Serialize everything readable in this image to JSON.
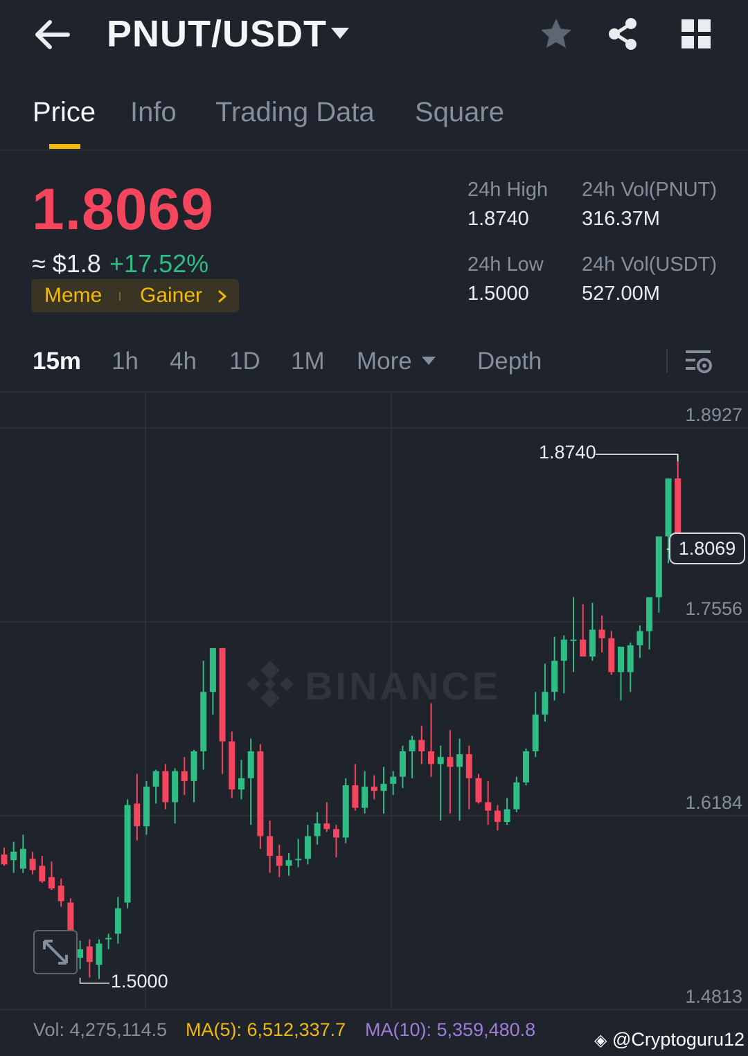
{
  "header": {
    "pair": "PNUT/USDT"
  },
  "tabs": [
    "Price",
    "Info",
    "Trading Data",
    "Square"
  ],
  "price": {
    "last": "1.8069",
    "approx": "≈ $1.8",
    "change": "+17.52%",
    "tags": [
      "Meme",
      "Gainer"
    ]
  },
  "stats": {
    "high_label": "24h High",
    "high": "1.8740",
    "low_label": "24h Low",
    "low": "1.5000",
    "vol_base_label": "24h Vol(PNUT)",
    "vol_base": "316.37M",
    "vol_quote_label": "24h Vol(USDT)",
    "vol_quote": "527.00M"
  },
  "intervals": [
    "15m",
    "1h",
    "4h",
    "1D",
    "1M",
    "More",
    "Depth"
  ],
  "chart": {
    "axis_labels": [
      "1.8927",
      "1.7556",
      "1.6184",
      "1.4813"
    ],
    "high_annotation": "1.8740",
    "low_annotation": "1.5000",
    "current_price": "1.8069",
    "watermark": "BINANCE"
  },
  "footer": {
    "vol": "Vol: 4,275,114.5",
    "ma5": "MA(5): 6,512,337.7",
    "ma10": "MA(10): 5,359,480.8",
    "credit": "@Cryptoguru12"
  },
  "colors": {
    "up": "#2ebd85",
    "down": "#f6465d",
    "accent": "#f0b90b",
    "ma5": "#f0b90b",
    "ma10": "#9c7ed8"
  },
  "chart_data": {
    "type": "candlestick",
    "y_range": [
      1.4813,
      1.8927
    ],
    "axis_ticks": [
      1.8927,
      1.7556,
      1.6184,
      1.4813
    ],
    "candles": [
      {
        "o": 1.591,
        "h": 1.596,
        "l": 1.583,
        "c": 1.584
      },
      {
        "o": 1.587,
        "h": 1.6,
        "l": 1.578,
        "c": 1.593
      },
      {
        "o": 1.581,
        "h": 1.605,
        "l": 1.578,
        "c": 1.595
      },
      {
        "o": 1.588,
        "h": 1.593,
        "l": 1.577,
        "c": 1.58
      },
      {
        "o": 1.583,
        "h": 1.59,
        "l": 1.571,
        "c": 1.572
      },
      {
        "o": 1.575,
        "h": 1.586,
        "l": 1.566,
        "c": 1.567
      },
      {
        "o": 1.569,
        "h": 1.574,
        "l": 1.554,
        "c": 1.558
      },
      {
        "o": 1.557,
        "h": 1.56,
        "l": 1.515,
        "c": 1.523
      },
      {
        "o": 1.518,
        "h": 1.53,
        "l": 1.51,
        "c": 1.524
      },
      {
        "o": 1.526,
        "h": 1.531,
        "l": 1.504,
        "c": 1.515
      },
      {
        "o": 1.513,
        "h": 1.531,
        "l": 1.503,
        "c": 1.528
      },
      {
        "o": 1.531,
        "h": 1.535,
        "l": 1.524,
        "c": 1.532
      },
      {
        "o": 1.535,
        "h": 1.561,
        "l": 1.528,
        "c": 1.553
      },
      {
        "o": 1.557,
        "h": 1.63,
        "l": 1.553,
        "c": 1.626
      },
      {
        "o": 1.627,
        "h": 1.648,
        "l": 1.601,
        "c": 1.611
      },
      {
        "o": 1.611,
        "h": 1.643,
        "l": 1.605,
        "c": 1.639
      },
      {
        "o": 1.639,
        "h": 1.651,
        "l": 1.627,
        "c": 1.65
      },
      {
        "o": 1.65,
        "h": 1.655,
        "l": 1.623,
        "c": 1.628
      },
      {
        "o": 1.628,
        "h": 1.652,
        "l": 1.613,
        "c": 1.65
      },
      {
        "o": 1.65,
        "h": 1.66,
        "l": 1.633,
        "c": 1.643
      },
      {
        "o": 1.643,
        "h": 1.665,
        "l": 1.628,
        "c": 1.664
      },
      {
        "o": 1.664,
        "h": 1.728,
        "l": 1.651,
        "c": 1.706
      },
      {
        "o": 1.706,
        "h": 1.734,
        "l": 1.69,
        "c": 1.737
      },
      {
        "o": 1.737,
        "h": 1.715,
        "l": 1.648,
        "c": 1.671
      },
      {
        "o": 1.671,
        "h": 1.678,
        "l": 1.631,
        "c": 1.637
      },
      {
        "o": 1.637,
        "h": 1.658,
        "l": 1.63,
        "c": 1.645
      },
      {
        "o": 1.645,
        "h": 1.673,
        "l": 1.612,
        "c": 1.664
      },
      {
        "o": 1.664,
        "h": 1.669,
        "l": 1.595,
        "c": 1.604
      },
      {
        "o": 1.604,
        "h": 1.615,
        "l": 1.578,
        "c": 1.59
      },
      {
        "o": 1.59,
        "h": 1.598,
        "l": 1.575,
        "c": 1.583
      },
      {
        "o": 1.583,
        "h": 1.592,
        "l": 1.576,
        "c": 1.587
      },
      {
        "o": 1.587,
        "h": 1.602,
        "l": 1.582,
        "c": 1.588
      },
      {
        "o": 1.588,
        "h": 1.612,
        "l": 1.584,
        "c": 1.604
      },
      {
        "o": 1.604,
        "h": 1.621,
        "l": 1.598,
        "c": 1.613
      },
      {
        "o": 1.613,
        "h": 1.628,
        "l": 1.607,
        "c": 1.609
      },
      {
        "o": 1.609,
        "h": 1.612,
        "l": 1.589,
        "c": 1.603
      },
      {
        "o": 1.603,
        "h": 1.645,
        "l": 1.599,
        "c": 1.64
      },
      {
        "o": 1.64,
        "h": 1.655,
        "l": 1.622,
        "c": 1.624
      },
      {
        "o": 1.624,
        "h": 1.65,
        "l": 1.62,
        "c": 1.639
      },
      {
        "o": 1.639,
        "h": 1.647,
        "l": 1.63,
        "c": 1.636
      },
      {
        "o": 1.636,
        "h": 1.653,
        "l": 1.62,
        "c": 1.641
      },
      {
        "o": 1.641,
        "h": 1.65,
        "l": 1.633,
        "c": 1.646
      },
      {
        "o": 1.646,
        "h": 1.668,
        "l": 1.638,
        "c": 1.664
      },
      {
        "o": 1.664,
        "h": 1.675,
        "l": 1.645,
        "c": 1.672
      },
      {
        "o": 1.672,
        "h": 1.682,
        "l": 1.655,
        "c": 1.664
      },
      {
        "o": 1.664,
        "h": 1.698,
        "l": 1.646,
        "c": 1.655
      },
      {
        "o": 1.655,
        "h": 1.668,
        "l": 1.615,
        "c": 1.66
      },
      {
        "o": 1.66,
        "h": 1.679,
        "l": 1.62,
        "c": 1.653
      },
      {
        "o": 1.653,
        "h": 1.673,
        "l": 1.615,
        "c": 1.662
      },
      {
        "o": 1.662,
        "h": 1.668,
        "l": 1.623,
        "c": 1.645
      },
      {
        "o": 1.645,
        "h": 1.648,
        "l": 1.627,
        "c": 1.628
      },
      {
        "o": 1.628,
        "h": 1.643,
        "l": 1.612,
        "c": 1.622
      },
      {
        "o": 1.622,
        "h": 1.626,
        "l": 1.608,
        "c": 1.614
      },
      {
        "o": 1.614,
        "h": 1.631,
        "l": 1.612,
        "c": 1.623
      },
      {
        "o": 1.623,
        "h": 1.646,
        "l": 1.621,
        "c": 1.642
      },
      {
        "o": 1.642,
        "h": 1.666,
        "l": 1.64,
        "c": 1.664
      },
      {
        "o": 1.664,
        "h": 1.706,
        "l": 1.66,
        "c": 1.69
      },
      {
        "o": 1.69,
        "h": 1.726,
        "l": 1.685,
        "c": 1.706
      },
      {
        "o": 1.706,
        "h": 1.745,
        "l": 1.7,
        "c": 1.728
      },
      {
        "o": 1.728,
        "h": 1.746,
        "l": 1.705,
        "c": 1.743
      },
      {
        "o": 1.743,
        "h": 1.773,
        "l": 1.72,
        "c": 1.743
      },
      {
        "o": 1.743,
        "h": 1.768,
        "l": 1.737,
        "c": 1.731
      },
      {
        "o": 1.731,
        "h": 1.769,
        "l": 1.728,
        "c": 1.75
      },
      {
        "o": 1.75,
        "h": 1.76,
        "l": 1.734,
        "c": 1.744
      },
      {
        "o": 1.744,
        "h": 1.749,
        "l": 1.718,
        "c": 1.72
      },
      {
        "o": 1.72,
        "h": 1.738,
        "l": 1.7,
        "c": 1.738
      },
      {
        "o": 1.72,
        "h": 1.741,
        "l": 1.706,
        "c": 1.739
      },
      {
        "o": 1.739,
        "h": 1.753,
        "l": 1.73,
        "c": 1.749
      },
      {
        "o": 1.749,
        "h": 1.766,
        "l": 1.736,
        "c": 1.773
      },
      {
        "o": 1.773,
        "h": 1.812,
        "l": 1.762,
        "c": 1.816
      },
      {
        "o": 1.816,
        "h": 1.854,
        "l": 1.797,
        "c": 1.857
      },
      {
        "o": 1.857,
        "h": 1.874,
        "l": 1.801,
        "c": 1.8069
      }
    ]
  }
}
